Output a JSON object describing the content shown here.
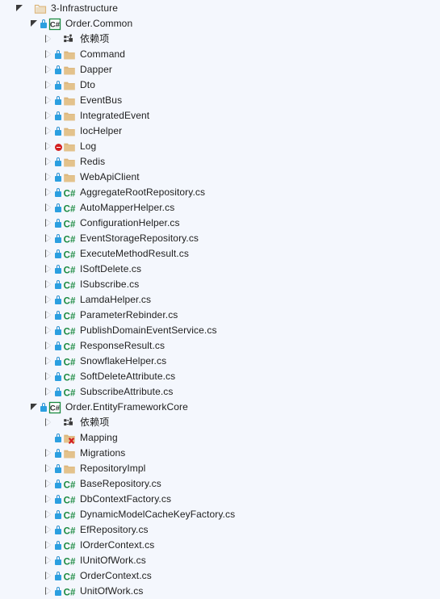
{
  "panel": {
    "name": "solution-explorer-tree",
    "background": "#f4f7fd",
    "text_color": "#1e1e1e",
    "accent_lock": "#2b9fe0",
    "accent_csharp": "#1a8a40",
    "accent_folder": "#dcb67a",
    "accent_error": "#d32020"
  },
  "tree": [
    {
      "label": "3-Infrastructure",
      "depth": 0,
      "expander": "expanded",
      "badge": "none",
      "icon": "solution-folder-icon"
    },
    {
      "label": "Order.Common",
      "depth": 1,
      "expander": "expanded",
      "badge": "lock",
      "icon": "csharp-project-icon"
    },
    {
      "label": "依赖项",
      "depth": 2,
      "expander": "collapsed",
      "badge": "none",
      "icon": "dependencies-icon"
    },
    {
      "label": "Command",
      "depth": 2,
      "expander": "collapsed",
      "badge": "lock",
      "icon": "folder-icon"
    },
    {
      "label": "Dapper",
      "depth": 2,
      "expander": "collapsed",
      "badge": "lock",
      "icon": "folder-icon"
    },
    {
      "label": "Dto",
      "depth": 2,
      "expander": "collapsed",
      "badge": "lock",
      "icon": "folder-icon"
    },
    {
      "label": "EventBus",
      "depth": 2,
      "expander": "collapsed",
      "badge": "lock",
      "icon": "folder-icon"
    },
    {
      "label": "IntegratedEvent",
      "depth": 2,
      "expander": "collapsed",
      "badge": "lock",
      "icon": "folder-icon"
    },
    {
      "label": "IocHelper",
      "depth": 2,
      "expander": "collapsed",
      "badge": "lock",
      "icon": "folder-icon"
    },
    {
      "label": "Log",
      "depth": 2,
      "expander": "collapsed",
      "badge": "excluded",
      "icon": "folder-icon"
    },
    {
      "label": "Redis",
      "depth": 2,
      "expander": "collapsed",
      "badge": "lock",
      "icon": "folder-icon"
    },
    {
      "label": "WebApiClient",
      "depth": 2,
      "expander": "collapsed",
      "badge": "lock",
      "icon": "folder-icon"
    },
    {
      "label": "AggregateRootRepository.cs",
      "depth": 2,
      "expander": "collapsed",
      "badge": "lock",
      "icon": "csharp-file-icon"
    },
    {
      "label": "AutoMapperHelper.cs",
      "depth": 2,
      "expander": "collapsed",
      "badge": "lock",
      "icon": "csharp-file-icon"
    },
    {
      "label": "ConfigurationHelper.cs",
      "depth": 2,
      "expander": "collapsed",
      "badge": "lock",
      "icon": "csharp-file-icon"
    },
    {
      "label": "EventStorageRepository.cs",
      "depth": 2,
      "expander": "collapsed",
      "badge": "lock",
      "icon": "csharp-file-icon"
    },
    {
      "label": "ExecuteMethodResult.cs",
      "depth": 2,
      "expander": "collapsed",
      "badge": "lock",
      "icon": "csharp-file-icon"
    },
    {
      "label": "ISoftDelete.cs",
      "depth": 2,
      "expander": "collapsed",
      "badge": "lock",
      "icon": "csharp-file-icon"
    },
    {
      "label": "ISubscribe.cs",
      "depth": 2,
      "expander": "collapsed",
      "badge": "lock",
      "icon": "csharp-file-icon"
    },
    {
      "label": "LamdaHelper.cs",
      "depth": 2,
      "expander": "collapsed",
      "badge": "lock",
      "icon": "csharp-file-icon"
    },
    {
      "label": "ParameterRebinder.cs",
      "depth": 2,
      "expander": "collapsed",
      "badge": "lock",
      "icon": "csharp-file-icon"
    },
    {
      "label": "PublishDomainEventService.cs",
      "depth": 2,
      "expander": "collapsed",
      "badge": "lock",
      "icon": "csharp-file-icon"
    },
    {
      "label": "ResponseResult.cs",
      "depth": 2,
      "expander": "collapsed",
      "badge": "lock",
      "icon": "csharp-file-icon"
    },
    {
      "label": "SnowflakeHelper.cs",
      "depth": 2,
      "expander": "collapsed",
      "badge": "lock",
      "icon": "csharp-file-icon"
    },
    {
      "label": "SoftDeleteAttribute.cs",
      "depth": 2,
      "expander": "collapsed",
      "badge": "lock",
      "icon": "csharp-file-icon"
    },
    {
      "label": "SubscribeAttribute.cs",
      "depth": 2,
      "expander": "collapsed",
      "badge": "lock",
      "icon": "csharp-file-icon"
    },
    {
      "label": "Order.EntityFrameworkCore",
      "depth": 1,
      "expander": "expanded",
      "badge": "lock",
      "icon": "csharp-project-icon"
    },
    {
      "label": "依赖项",
      "depth": 2,
      "expander": "collapsed",
      "badge": "none",
      "icon": "dependencies-icon"
    },
    {
      "label": "Mapping",
      "depth": 2,
      "expander": "none",
      "badge": "lock",
      "icon": "folder-error-icon"
    },
    {
      "label": "Migrations",
      "depth": 2,
      "expander": "collapsed",
      "badge": "lock",
      "icon": "folder-icon"
    },
    {
      "label": "RepositoryImpl",
      "depth": 2,
      "expander": "collapsed",
      "badge": "lock",
      "icon": "folder-icon"
    },
    {
      "label": "BaseRepository.cs",
      "depth": 2,
      "expander": "collapsed",
      "badge": "lock",
      "icon": "csharp-file-icon"
    },
    {
      "label": "DbContextFactory.cs",
      "depth": 2,
      "expander": "collapsed",
      "badge": "lock",
      "icon": "csharp-file-icon"
    },
    {
      "label": "DynamicModelCacheKeyFactory.cs",
      "depth": 2,
      "expander": "collapsed",
      "badge": "lock",
      "icon": "csharp-file-icon"
    },
    {
      "label": "EfRepository.cs",
      "depth": 2,
      "expander": "collapsed",
      "badge": "lock",
      "icon": "csharp-file-icon"
    },
    {
      "label": "IOrderContext.cs",
      "depth": 2,
      "expander": "collapsed",
      "badge": "lock",
      "icon": "csharp-file-icon"
    },
    {
      "label": "IUnitOfWork.cs",
      "depth": 2,
      "expander": "collapsed",
      "badge": "lock",
      "icon": "csharp-file-icon"
    },
    {
      "label": "OrderContext.cs",
      "depth": 2,
      "expander": "collapsed",
      "badge": "lock",
      "icon": "csharp-file-icon"
    },
    {
      "label": "UnitOfWork.cs",
      "depth": 2,
      "expander": "collapsed",
      "badge": "lock",
      "icon": "csharp-file-icon"
    }
  ]
}
